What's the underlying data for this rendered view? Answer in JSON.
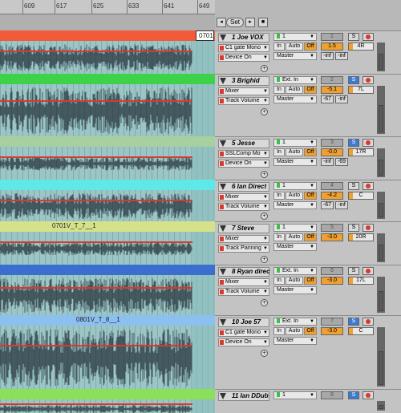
{
  "ruler": {
    "ticks": [
      "609",
      "617",
      "625",
      "633",
      "641",
      "649"
    ]
  },
  "toolbar": {
    "set_label": "Set"
  },
  "tracks": [
    {
      "name": "1 Joe VOX",
      "number": "1",
      "color": "#f25a3c",
      "clip_label": "0701",
      "device1": "C1 gate Mono",
      "device2": "Device On",
      "input": "1",
      "vol": "1.5",
      "pan": "4R",
      "send_a": "-inf",
      "send_b": "-inf",
      "solo_active": false
    },
    {
      "name": "3 Brighid",
      "number": "2",
      "color": "#3ed14a",
      "clip_label": "",
      "device1": "Mixer",
      "device2": "Track Volume",
      "input": "Ext. In",
      "vol": "-5.1",
      "pan": "7L",
      "send_a": "-67",
      "send_b": "-inf",
      "solo_active": true
    },
    {
      "name": "5 Jesse",
      "number": "3",
      "color": "#a8cfa0",
      "clip_label": "",
      "device1": "SSLComp Mo",
      "device2": "Device On",
      "input": "1",
      "vol": "-0.0",
      "pan": "17R",
      "send_a": "-inf",
      "send_b": "-69",
      "solo_active": true
    },
    {
      "name": "6 Ian Direct",
      "number": "4",
      "color": "#5fe8e8",
      "clip_label": "",
      "device1": "Mixer",
      "device2": "Track Volume",
      "input": "1",
      "vol": "-4.2",
      "pan": "C",
      "send_a": "-67",
      "send_b": "-inf",
      "solo_active": false
    },
    {
      "name": "7 Steve",
      "number": "5",
      "color": "#d6e28a",
      "clip_label": "0701V_T_7__1",
      "device1": "Mixer",
      "device2": "Track Panning",
      "input": "1",
      "vol": "-3.0",
      "pan": "20R",
      "send_a": "",
      "send_b": "",
      "solo_active": false
    },
    {
      "name": "8 Ryan direc",
      "number": "6",
      "color": "#3a6fd0",
      "clip_label": "",
      "device1": "Mixer",
      "device2": "Track Volume",
      "input": "Ext. In",
      "vol": "-3.0",
      "pan": "17L",
      "send_a": "",
      "send_b": "",
      "solo_active": false
    },
    {
      "name": "10 Joe 57",
      "number": "7",
      "color": "#8cc0f0",
      "clip_label": "0801V_T_8__1",
      "device1": "C1 gate Mono",
      "device2": "Device On",
      "input": "Ext. In",
      "vol": "-3.0",
      "pan": "C",
      "send_a": "",
      "send_b": "",
      "solo_active": true
    },
    {
      "name": "11 Ian DDub",
      "number": "8",
      "color": "#8be05a",
      "clip_label": "",
      "device1": "",
      "device2": "",
      "input": "1",
      "vol": "",
      "pan": "",
      "send_a": "",
      "send_b": "",
      "solo_active": true
    }
  ],
  "labels": {
    "master": "Master",
    "in": "In",
    "auto": "Auto",
    "off": "Off",
    "solo": "S"
  }
}
